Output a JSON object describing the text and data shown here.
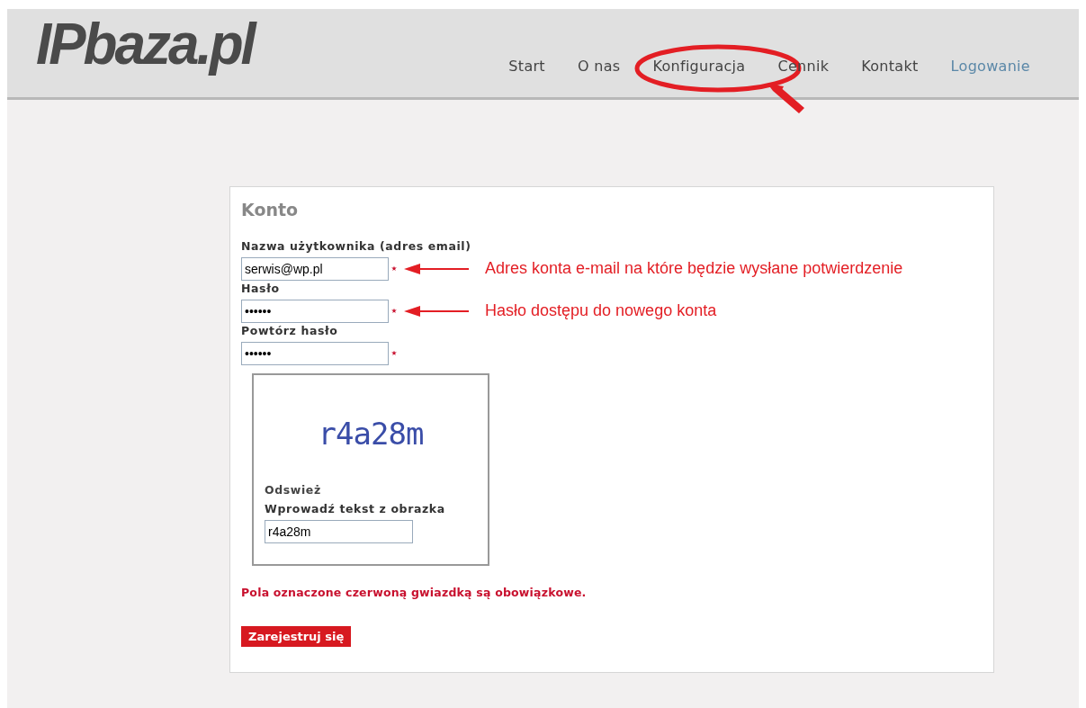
{
  "header": {
    "logo": "IPbaza.pl",
    "nav": [
      {
        "label": "Start",
        "selected": false,
        "highlighted": false
      },
      {
        "label": "O nas",
        "selected": false,
        "highlighted": false
      },
      {
        "label": "Konfiguracja",
        "selected": false,
        "highlighted": true
      },
      {
        "label": "Cennik",
        "selected": false,
        "highlighted": false
      },
      {
        "label": "Kontakt",
        "selected": false,
        "highlighted": false
      },
      {
        "label": "Logowanie",
        "selected": true,
        "highlighted": false
      }
    ]
  },
  "form": {
    "title": "Konto",
    "fields": [
      {
        "label": "Nazwa użytkownika (adres email)",
        "value": "serwis@wp.pl",
        "required": true,
        "note": "Adres konta e-mail na które będzie wysłane potwierdzenie"
      },
      {
        "label": "Hasło",
        "value": "••••••",
        "required": true,
        "note": "Hasło dostępu do nowego konta"
      },
      {
        "label": "Powtórz hasło",
        "value": "••••••",
        "required": true
      }
    ],
    "captcha": {
      "image_text": "r4a28m",
      "refresh": "Odswież",
      "label": "Wprowadź tekst z obrazka",
      "value": "r4a28m"
    },
    "required_note": "Pola oznaczone czerwoną gwiazdką są obowiązkowe.",
    "submit": "Zarejestruj się"
  }
}
